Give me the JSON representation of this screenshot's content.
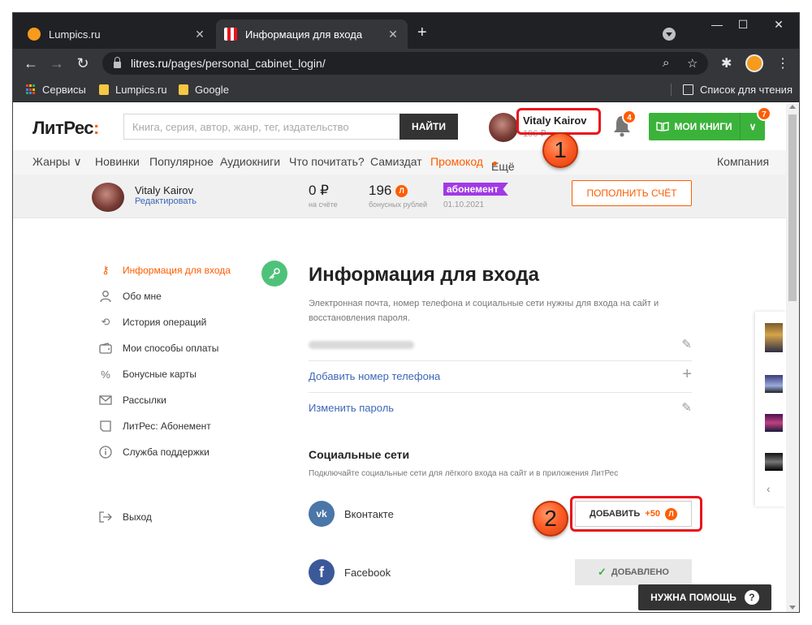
{
  "browser": {
    "tabs": [
      {
        "label": "Lumpics.ru",
        "active": false
      },
      {
        "label": "Информация для входа",
        "active": true
      }
    ],
    "url_host": "litres.ru",
    "url_path": "/pages/personal_cabinet_login/",
    "bookmarks": [
      {
        "label": "Сервисы"
      },
      {
        "label": "Lumpics.ru"
      },
      {
        "label": "Google"
      }
    ],
    "reading_list": "Список для чтения",
    "new_tab_symbol": "+",
    "close_symbol": "✕",
    "minimize_symbol": "—",
    "maximize_symbol": "☐",
    "winclose_symbol": "✕"
  },
  "header": {
    "logo_main": "ЛитРес",
    "logo_accent": ":",
    "search_placeholder": "Книга, серия, автор, жанр, тег, издательство",
    "search_button": "НАЙТИ",
    "user_name": "Vitaly Kairov",
    "user_sub": "196 ₽",
    "notifications_count": "4",
    "my_books": "МОИ КНИГИ",
    "my_books_count": "7"
  },
  "menu": {
    "items": [
      {
        "label": "Жанры ∨"
      },
      {
        "label": "Новинки"
      },
      {
        "label": "Популярное"
      },
      {
        "label": "Аудиокниги"
      },
      {
        "label": "Что почитать?"
      },
      {
        "label": "Самиздат"
      },
      {
        "label": "Промокод"
      },
      {
        "label": "Ещё"
      }
    ],
    "company": "Компания"
  },
  "account": {
    "name": "Vitaly Kairov",
    "edit": "Редактировать",
    "balance": "0 ₽",
    "balance_sub": "на счёте",
    "bonus": "196",
    "bonus_badge": "Л",
    "bonus_sub": "бонусных рублей",
    "subscription": "абонемент",
    "subscription_date": "01.10.2021",
    "topup": "ПОПОЛНИТЬ СЧЁТ"
  },
  "sidebar": {
    "items": [
      {
        "label": "Информация для входа",
        "icon": "key-icon"
      },
      {
        "label": "Обо мне",
        "icon": "user-icon"
      },
      {
        "label": "История операций",
        "icon": "history-icon"
      },
      {
        "label": "Мои способы оплаты",
        "icon": "wallet-icon"
      },
      {
        "label": "Бонусные карты",
        "icon": "percent-icon"
      },
      {
        "label": "Рассылки",
        "icon": "mail-icon"
      },
      {
        "label": "ЛитРес: Абонемент",
        "icon": "subscription-icon"
      },
      {
        "label": "Служба поддержки",
        "icon": "info-icon"
      }
    ],
    "logout": "Выход"
  },
  "main": {
    "title": "Информация для входа",
    "description": "Электронная почта, номер телефона и социальные сети нужны для входа на сайт и восстановления пароля.",
    "add_phone": "Добавить номер телефона",
    "change_password": "Изменить пароль",
    "social_title": "Социальные сети",
    "social_desc": "Подключайте социальные сети для лёгкого входа на сайт и в приложения ЛитРес",
    "vk_label": "Вконтакте",
    "vk_icon_text": "vk",
    "add_label": "ДОБАВИТЬ",
    "add_bonus": "+50",
    "fb_label": "Facebook",
    "fb_icon_text": "f",
    "added_label": "ДОБАВЛЕНО"
  },
  "annotations": {
    "step1": "1",
    "step2": "2"
  },
  "help": {
    "label": "НУЖНА ПОМОЩЬ",
    "q": "?"
  },
  "colors": {
    "accent": "#ff5c00",
    "green": "#3bb33b",
    "link": "#3d67b7",
    "subscription": "#a139e4"
  }
}
